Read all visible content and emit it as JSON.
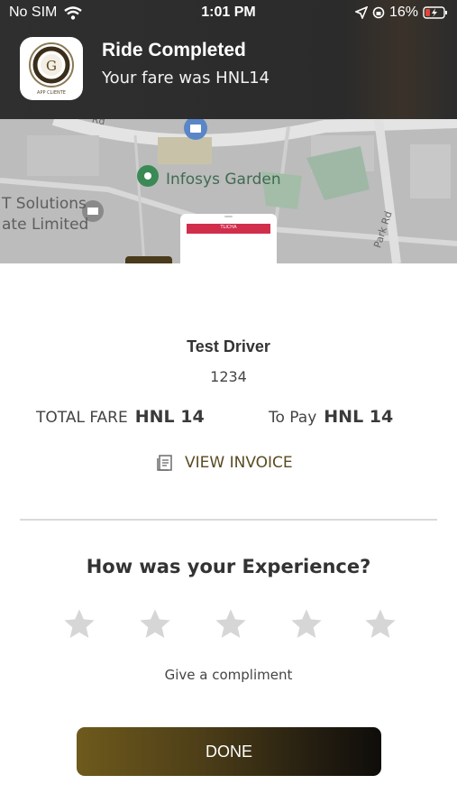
{
  "status_bar": {
    "carrier": "No SIM",
    "time": "1:01 PM",
    "battery": "16%"
  },
  "notification": {
    "app_caption": "APP CLIENTE",
    "title": "Ride Completed",
    "body": "Your fare was HNL14"
  },
  "map": {
    "road_label_top": "Rd",
    "poi_garden": "Infosys Garden",
    "poi_solutions_line1": "T Solutions",
    "poi_solutions_line2": "ate Limited",
    "road_label_right": "Park Rd"
  },
  "phone_preview": {
    "bar_text": "TLICHA"
  },
  "driver": {
    "name": "Test Driver",
    "id": "1234"
  },
  "fare": {
    "total_label": "TOTAL FARE",
    "total_value": "HNL 14",
    "to_pay_label": "To Pay",
    "to_pay_value": "HNL 14"
  },
  "invoice": {
    "label": "VIEW INVOICE"
  },
  "rating": {
    "title": "How was your Experience?",
    "stars_total": 5,
    "stars_selected": 0,
    "compliment": "Give a compliment"
  },
  "actions": {
    "done_label": "DONE"
  },
  "colors": {
    "accent_gold": "#5b4a22",
    "banner_bg": "#2f2f2f",
    "star_empty": "#d6d6d6"
  }
}
